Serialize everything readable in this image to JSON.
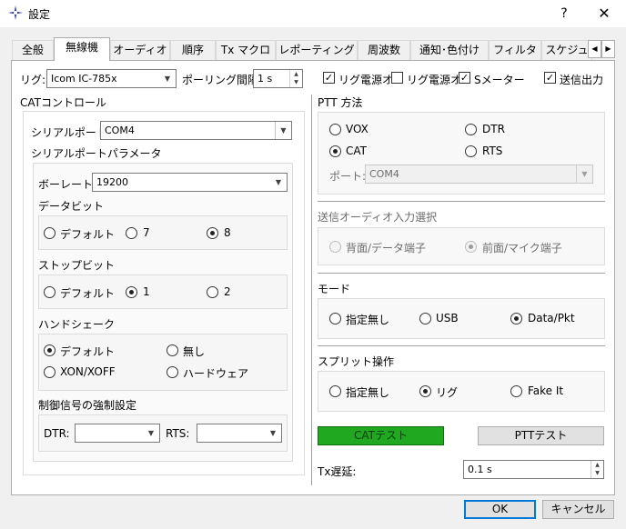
{
  "window": {
    "title": "設定",
    "help": "?",
    "close": "✕"
  },
  "tabs": [
    "全般",
    "無線機",
    "オーディオ",
    "順序",
    "Tx マクロ",
    "レポーティング",
    "周波数",
    "通知･色付け",
    "フィルタ",
    "スケジュ"
  ],
  "tab_scroll": {
    "left": "◀",
    "right": "▶"
  },
  "rig": {
    "label": "リグ:",
    "value": "Icom IC-785x",
    "polling_label": "ポーリング間隔:",
    "polling_value": "1 s"
  },
  "checks": [
    {
      "label": "リグ電源オ",
      "checked": true
    },
    {
      "label": "リグ電源オ",
      "checked": false
    },
    {
      "label": "Sメーター",
      "checked": true
    },
    {
      "label": "送信出力",
      "checked": true
    }
  ],
  "cat": {
    "title": "CATコントロール",
    "serial_port_label": "シリアルポート:",
    "serial_port_value": "COM4",
    "serial_params_label": "シリアルポートパラメータ",
    "baud_label": "ボーレート:",
    "baud_value": "19200",
    "databits_label": "データビット",
    "databits": [
      "デフォルト",
      "7",
      "8"
    ],
    "stopbits_label": "ストップビット",
    "stopbits": [
      "デフォルト",
      "1",
      "2"
    ],
    "handshake_label": "ハンドシェーク",
    "handshake": [
      "デフォルト",
      "無し",
      "XON/XOFF",
      "ハードウェア"
    ],
    "force_label": "制御信号の強制設定",
    "dtr_label": "DTR:",
    "rts_label": "RTS:"
  },
  "ptt": {
    "title": "PTT 方法",
    "options": [
      "VOX",
      "DTR",
      "CAT",
      "RTS"
    ],
    "port_label": "ポート:",
    "port_value": "COM4"
  },
  "audio": {
    "title": "送信オーディオ入力選択",
    "options": [
      "背面/データ端子",
      "前面/マイク端子"
    ]
  },
  "mode": {
    "title": "モード",
    "options": [
      "指定無し",
      "USB",
      "Data/Pkt"
    ]
  },
  "split": {
    "title": "スプリット操作",
    "options": [
      "指定無し",
      "リグ",
      "Fake It"
    ]
  },
  "buttons": {
    "cat_test": "CATテスト",
    "ptt_test": "PTTテスト",
    "ok": "OK",
    "cancel": "キャンセル"
  },
  "tx_delay": {
    "label": "Tx遅延:",
    "value": "0.1 s"
  },
  "check_mark": "✓",
  "colors": {
    "cat_test_green": "#20a820",
    "accent": "#0078d7"
  }
}
